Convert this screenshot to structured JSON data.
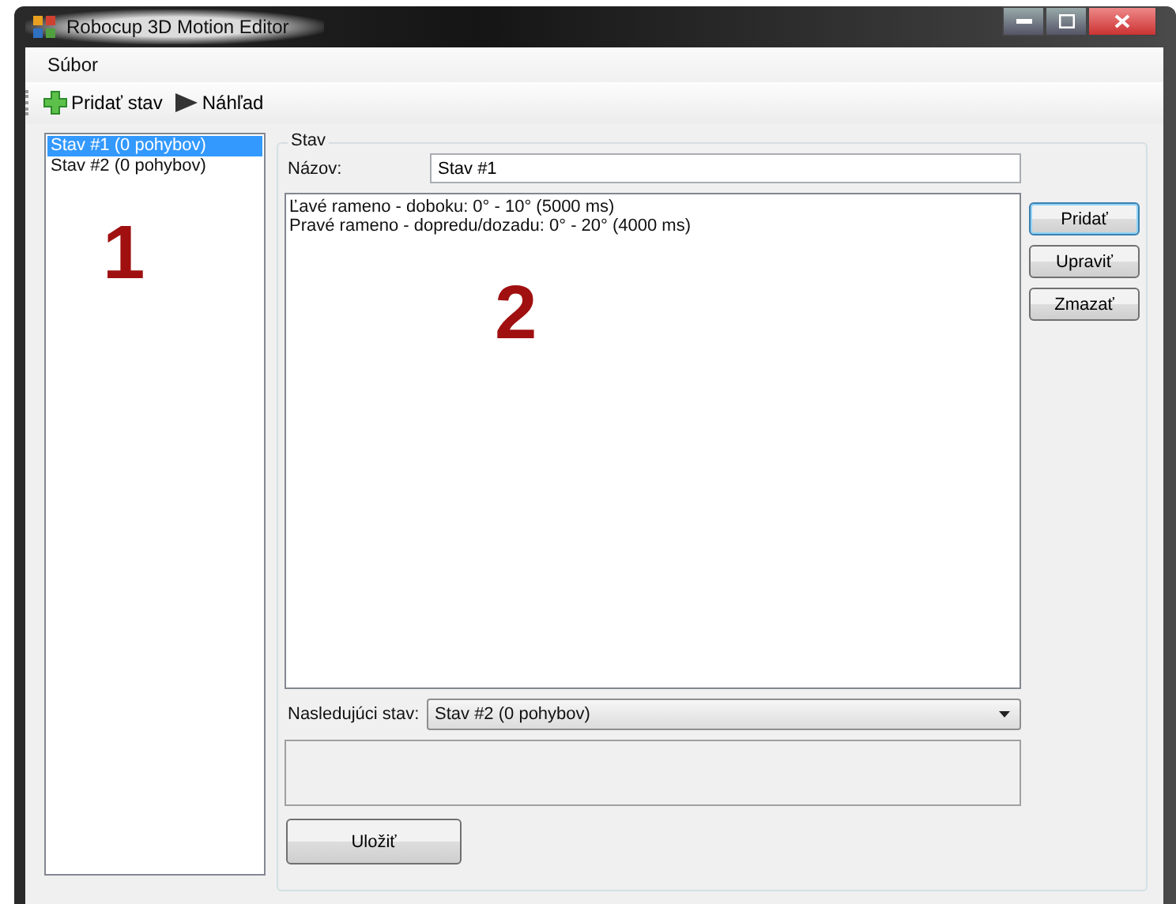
{
  "window": {
    "title": "Robocup 3D Motion Editor"
  },
  "menu": [
    "Súbor"
  ],
  "toolbar": [
    {
      "label": "Pridať stav",
      "kind": "add"
    },
    {
      "label": "Náhľad",
      "kind": "play"
    }
  ],
  "states_list": [
    {
      "label": "Stav #1 (0 pohybov)",
      "selected": true
    },
    {
      "label": "Stav #2 (0 pohybov)",
      "selected": false
    }
  ],
  "group": {
    "title": "Stav",
    "name_label": "Názov:",
    "name_value": "Stav #1",
    "motions": [
      "Ľavé rameno - doboku: 0° - 10° (5000 ms)",
      "Pravé rameno - dopredu/dozadu: 0° - 20° (4000 ms)"
    ],
    "buttons": [
      {
        "label": "Pridať",
        "focused": true
      },
      {
        "label": "Upraviť",
        "focused": false
      },
      {
        "label": "Zmazať",
        "focused": false
      }
    ],
    "next_label": "Nasledujúci stav:",
    "next_value": "Stav #2 (0 pohybov)",
    "save": "Uložiť"
  },
  "annotations": [
    "1",
    "2"
  ]
}
